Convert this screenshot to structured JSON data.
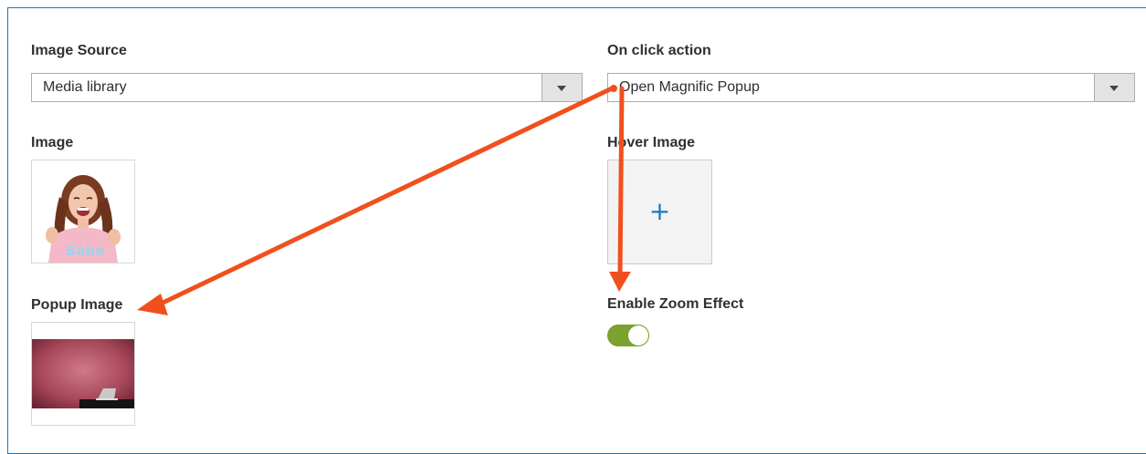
{
  "image_source": {
    "label": "Image Source",
    "selected": "Media library"
  },
  "on_click_action": {
    "label": "On click action",
    "selected": "Open Magnific Popup"
  },
  "image": {
    "label": "Image"
  },
  "hover_image": {
    "label": "Hover Image",
    "add_symbol": "+"
  },
  "popup_image": {
    "label": "Popup Image"
  },
  "zoom_effect": {
    "label": "Enable Zoom Effect",
    "enabled": true
  },
  "colors": {
    "frame_border": "#1979c3",
    "toggle_on": "#79a22e",
    "annotation_arrow": "#f0501e",
    "plus": "#1979c3"
  },
  "icons": {
    "select_arrow": "chevron-down-icon",
    "add": "plus-icon",
    "annotation": "arrow-icon"
  }
}
